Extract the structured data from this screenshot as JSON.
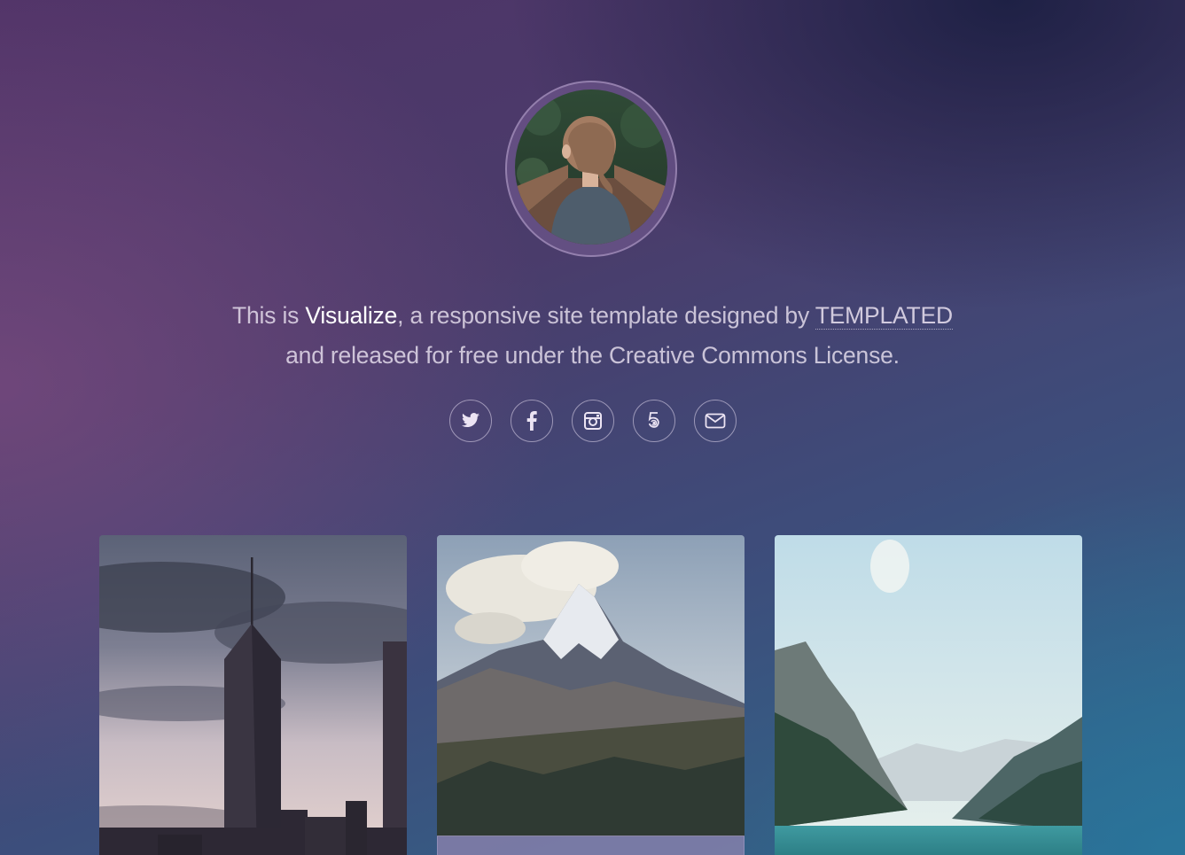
{
  "intro": {
    "prefix": "This is ",
    "brand": "Visualize",
    "middle": ", a responsive site template designed by ",
    "author_link": "TEMPLATED",
    "line2": "and released for free under the Creative Commons License."
  },
  "socials": [
    {
      "icon": "twitter-icon",
      "label": "Twitter"
    },
    {
      "icon": "facebook-icon",
      "label": "Facebook"
    },
    {
      "icon": "instagram-icon",
      "label": "Instagram"
    },
    {
      "icon": "500px-icon",
      "label": "500px"
    },
    {
      "icon": "envelope-icon",
      "label": "Email"
    }
  ],
  "gallery": [
    {
      "subject": "city-skyscraper"
    },
    {
      "subject": "snowy-mountain-peak"
    },
    {
      "subject": "mountain-lake-valley"
    }
  ],
  "colors": {
    "bg_top_left": "#4f3367",
    "bg_bottom_right": "#2e6a8c",
    "text": "#efe8f5"
  }
}
